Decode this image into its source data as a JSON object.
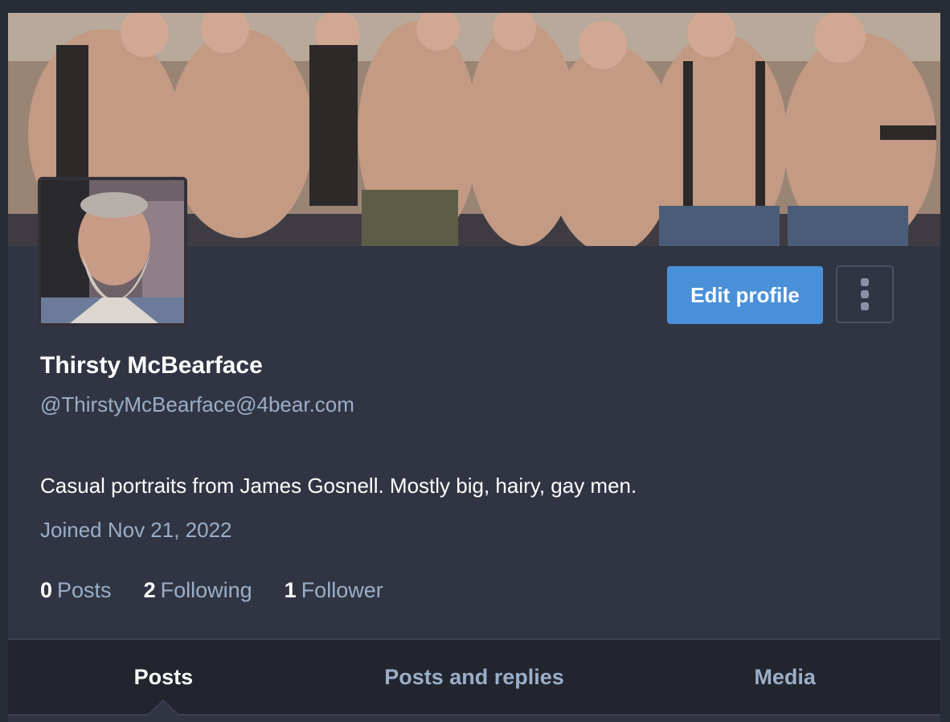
{
  "colors": {
    "accent": "#4a90d9",
    "background": "#282c37",
    "card": "#313543",
    "muted_text": "#9baec8",
    "tab_bar": "#22252e"
  },
  "header_image": {
    "alt_icon": "header-photo-icon"
  },
  "avatar": {
    "icon": "avatar-photo-icon"
  },
  "actions": {
    "edit_profile_label": "Edit profile",
    "more_icon": "vertical-ellipsis-icon"
  },
  "profile": {
    "display_name": "Thirsty McBearface",
    "handle": "@ThirstyMcBearface@4bear.com",
    "bio": "Casual portraits from James Gosnell. Mostly big, hairy, gay men.",
    "joined": "Joined Nov 21, 2022"
  },
  "stats": [
    {
      "count": "0",
      "label": "Posts"
    },
    {
      "count": "2",
      "label": "Following"
    },
    {
      "count": "1",
      "label": "Follower"
    }
  ],
  "tabs": [
    {
      "label": "Posts",
      "active": true
    },
    {
      "label": "Posts and replies",
      "active": false
    },
    {
      "label": "Media",
      "active": false
    }
  ]
}
